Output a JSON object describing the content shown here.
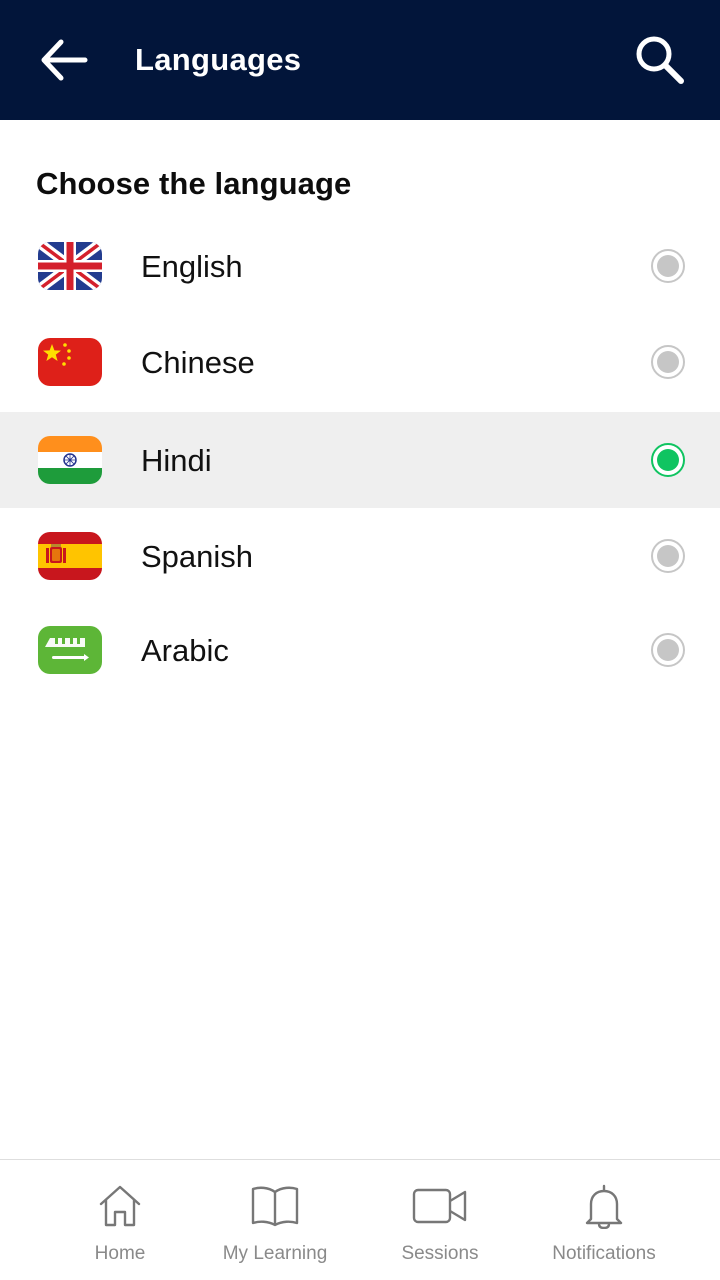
{
  "header": {
    "title": "Languages",
    "back_icon": "arrow-left-icon",
    "search_icon": "search-icon",
    "background": "#02153a"
  },
  "content": {
    "heading": "Choose the language",
    "selected": "Hindi",
    "accent_color": "#10c461",
    "languages": [
      {
        "label": "English",
        "flag": "uk-flag-icon",
        "selected": false
      },
      {
        "label": "Chinese",
        "flag": "china-flag-icon",
        "selected": false
      },
      {
        "label": "Hindi",
        "flag": "india-flag-icon",
        "selected": true
      },
      {
        "label": "Spanish",
        "flag": "spain-flag-icon",
        "selected": false
      },
      {
        "label": "Arabic",
        "flag": "saudi-arabia-flag-icon",
        "selected": false
      }
    ]
  },
  "bottom_nav": {
    "items": [
      {
        "label": "Home",
        "icon": "home-icon"
      },
      {
        "label": "My Learning",
        "icon": "book-icon"
      },
      {
        "label": "Sessions",
        "icon": "video-camera-icon"
      },
      {
        "label": "Notifications",
        "icon": "bell-icon"
      }
    ]
  }
}
